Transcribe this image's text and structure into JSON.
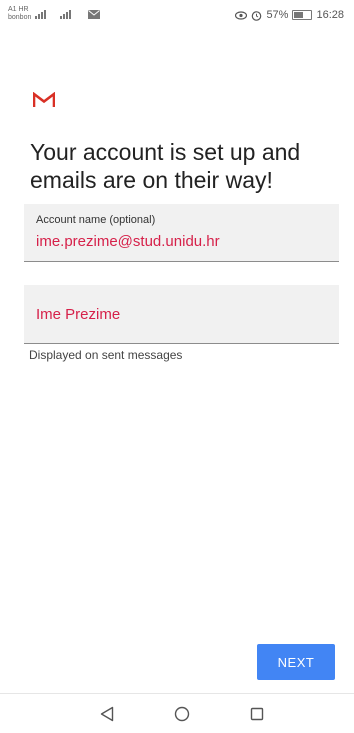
{
  "status_bar": {
    "carrier_line1": "A1 HR",
    "carrier_line2": "bonbon",
    "battery": "57%",
    "time": "16:28",
    "icons": [
      "signal-icon",
      "signal-icon",
      "mail-icon",
      "eye-icon",
      "alarm-icon",
      "battery-icon"
    ]
  },
  "header": {
    "logo": "gmail-logo-icon",
    "title": "Your account is set up and emails are on their way!"
  },
  "account_field": {
    "label": "Account name (optional)",
    "value": "ime.prezime@stud.unidu.hr"
  },
  "name_field": {
    "value": "Ime Prezime",
    "helper": "Displayed on sent messages"
  },
  "actions": {
    "next_label": "NEXT"
  },
  "nav_bar": {
    "icons": [
      "back-icon",
      "home-icon",
      "recents-icon"
    ]
  },
  "colors": {
    "accent": "#4285f4",
    "input_text": "#d6214a",
    "gmail_red": "#d93025",
    "field_bg": "#f1f1f1"
  }
}
